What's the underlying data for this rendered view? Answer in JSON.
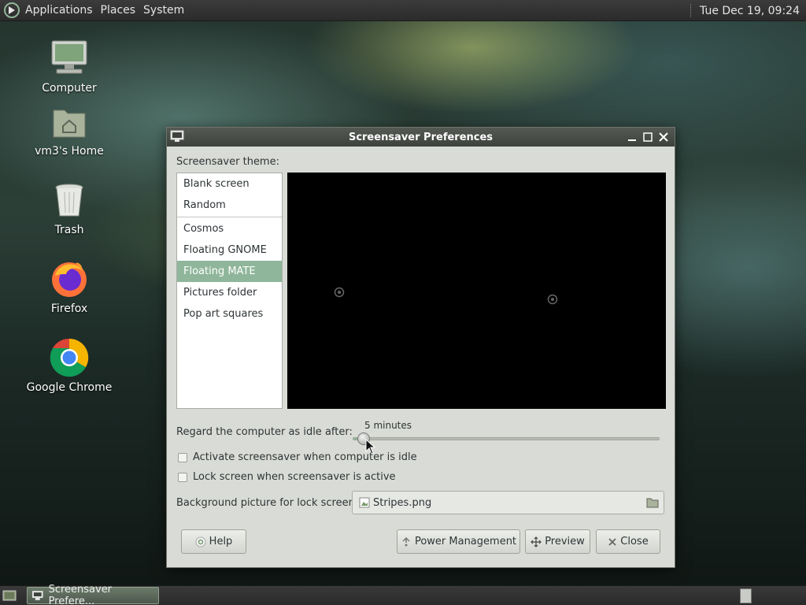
{
  "top_panel": {
    "menus": [
      "Applications",
      "Places",
      "System"
    ],
    "clock": "Tue Dec 19, 09:24"
  },
  "desktop": {
    "icons": [
      {
        "label": "Computer",
        "icon": "computer-icon"
      },
      {
        "label": "vm3's Home",
        "icon": "home-folder-icon"
      },
      {
        "label": "Trash",
        "icon": "trash-icon"
      },
      {
        "label": "Firefox",
        "icon": "firefox-icon"
      },
      {
        "label": "Google Chrome",
        "icon": "chrome-icon"
      }
    ]
  },
  "dialog": {
    "title": "Screensaver Preferences",
    "theme_label": "Screensaver theme:",
    "themes_top": [
      "Blank screen",
      "Random"
    ],
    "themes": [
      "Cosmos",
      "Floating GNOME",
      "Floating MATE",
      "Pictures folder",
      "Pop art squares"
    ],
    "selected_theme": "Floating MATE",
    "idle_label": "Regard the computer as idle after:",
    "idle_value": "5 minutes",
    "idle_fraction": 0.04,
    "activate_label": "Activate screensaver when computer is idle",
    "activate_checked": false,
    "lock_label": "Lock screen when screensaver is active",
    "lock_checked": false,
    "bg_label": "Background picture for lock screen:",
    "bg_file": "Stripes.png",
    "buttons": {
      "help": "Help",
      "power": "Power Management",
      "preview": "Preview",
      "close": "Close"
    }
  },
  "bottom_panel": {
    "task": "Screensaver Prefere..."
  },
  "colors": {
    "selection": "#8fb69a",
    "panel": "#2f2f2f"
  }
}
